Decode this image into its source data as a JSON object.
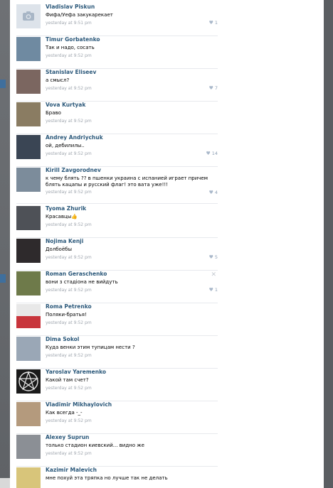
{
  "comments": [
    {
      "author": "Vladislav Piskun",
      "text": "Фифа/Уефа закукарекает",
      "time": "yesterday at 9:51 pm",
      "likes": "1",
      "avatar_icon": "camera-icon",
      "avatar_color": "#dde3ea"
    },
    {
      "author": "Timur Gorbatenko",
      "text": "Так и надо, сосать",
      "time": "yesterday at 9:52 pm",
      "likes": "",
      "avatar_color": "#6f8aa1"
    },
    {
      "author": "Stanislav Eliseev",
      "text": "а смысл?",
      "time": "yesterday at 9:52 pm",
      "likes": "7",
      "avatar_color": "#7b6660"
    },
    {
      "author": "Vova Kurtyak",
      "text": "Браво",
      "time": "yesterday at 9:52 pm",
      "likes": "",
      "avatar_color": "#8a7c62"
    },
    {
      "author": "Andrey Andriychuk",
      "text": "ой, дебилилы..",
      "time": "yesterday at 9:52 pm",
      "likes": "14",
      "avatar_color": "#3a4554"
    },
    {
      "author": "Kirill Zavgorodnev",
      "text": "к чему блять ?? в пшенки украина с испанией играет причем",
      "text2": "блять кацапы и русский флаг! это вата уже!!!",
      "time": "yesterday at 9:52 pm",
      "likes": "4",
      "avatar_color": "#7c8c9b"
    },
    {
      "author": "Tyoma Zhurik",
      "text": "Красавцы👍",
      "time": "yesterday at 9:52 pm",
      "likes": "",
      "avatar_color": "#4e5157"
    },
    {
      "author": "Nojima Kenji",
      "text": "Долбоёбы",
      "time": "yesterday at 9:52 pm",
      "likes": "5",
      "avatar_color": "#2e2a2c"
    },
    {
      "author": "Roman Geraschenko",
      "text": "вони з стадіона не вийдуть",
      "time": "yesterday at 9:52 pm",
      "likes": "1",
      "avatar_color": "#6e7a4a"
    },
    {
      "author": "Roma Petrenko",
      "text": "Поляки-братья!",
      "time": "yesterday at 9:52 pm",
      "likes": "",
      "avatar_color": "#c8c8c8"
    },
    {
      "author": "Dima Sokol",
      "text": "Куда венки этим тупицам нести ?",
      "time": "yesterday at 9:52 pm",
      "likes": "",
      "avatar_color": "#9aa7b6"
    },
    {
      "author": "Yaroslav Yaremenko",
      "text": "Какой там счет?",
      "time": "yesterday at 9:52 pm",
      "likes": "",
      "avatar_color": "#1b1b1b"
    },
    {
      "author": "Vladimir Mikhaylovich",
      "text": "Как всегда -_-",
      "time": "yesterday at 9:52 pm",
      "likes": "",
      "avatar_color": "#b49a7d"
    },
    {
      "author": "Alexey Suprun",
      "text": "только стадион киевский... видно же",
      "time": "yesterday at 9:52 pm",
      "likes": "",
      "avatar_color": "#8b8f95"
    },
    {
      "author": "Kazimir Malevich",
      "text": "мне похуй эта тряпка но лучше так не делать",
      "time": "",
      "likes": "",
      "avatar_color": "#d8c57a"
    }
  ]
}
